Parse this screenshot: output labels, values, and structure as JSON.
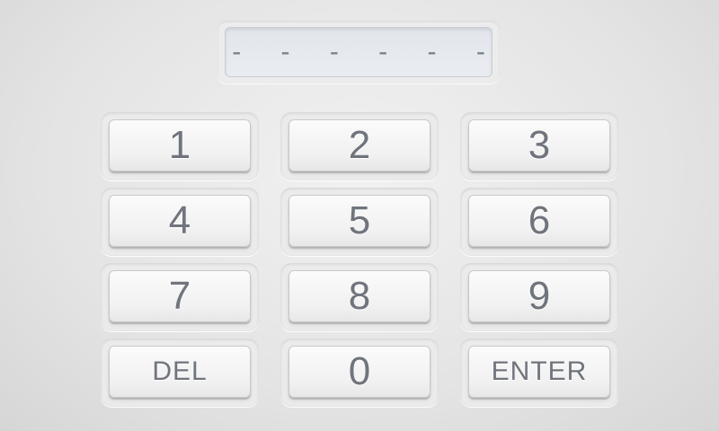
{
  "display": {
    "value": "- - - - - -"
  },
  "keys": {
    "k1": "1",
    "k2": "2",
    "k3": "3",
    "k4": "4",
    "k5": "5",
    "k6": "6",
    "k7": "7",
    "k8": "8",
    "k9": "9",
    "del": "DEL",
    "k0": "0",
    "enter": "ENTER"
  }
}
